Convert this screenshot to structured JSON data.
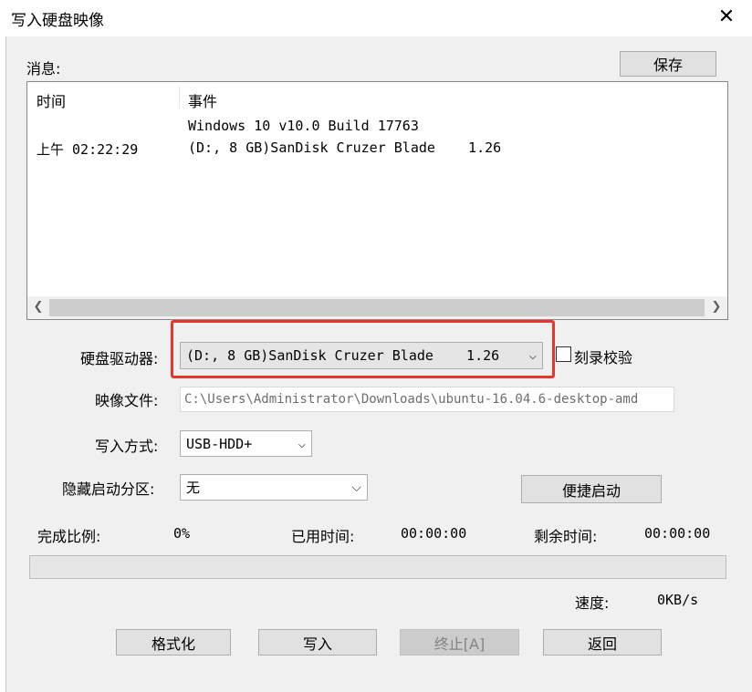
{
  "window": {
    "title": "写入硬盘映像"
  },
  "messages": {
    "label": "消息:",
    "save_label": "保存",
    "headers": {
      "time": "时间",
      "event": "事件"
    },
    "rows": [
      {
        "time": "",
        "event": "Windows 10 v10.0 Build 17763"
      },
      {
        "time": "上午 02:22:29",
        "event": "(D:, 8 GB)SanDisk Cruzer Blade    1.26"
      }
    ]
  },
  "drive": {
    "label": "硬盘驱动器:",
    "value": "(D:, 8 GB)SanDisk Cruzer Blade    1.26"
  },
  "verify": {
    "label": "刻录校验"
  },
  "image_file": {
    "label": "映像文件:",
    "value": "C:\\Users\\Administrator\\Downloads\\ubuntu-16.04.6-desktop-amd"
  },
  "write_mode": {
    "label": "写入方式:",
    "value": "USB-HDD+"
  },
  "hidden_partition": {
    "label": "隐藏启动分区:",
    "value": "无"
  },
  "quick_boot_label": "便捷启动",
  "progress": {
    "complete_label": "完成比例:",
    "complete_value": "0%",
    "elapsed_label": "已用时间:",
    "elapsed_value": "00:00:00",
    "remaining_label": "剩余时间:",
    "remaining_value": "00:00:00",
    "fraction": 0,
    "speed_label": "速度:",
    "speed_value": "0KB/s"
  },
  "buttons": {
    "format": "格式化",
    "write": "写入",
    "stop": "终止[A]",
    "back": "返回"
  }
}
